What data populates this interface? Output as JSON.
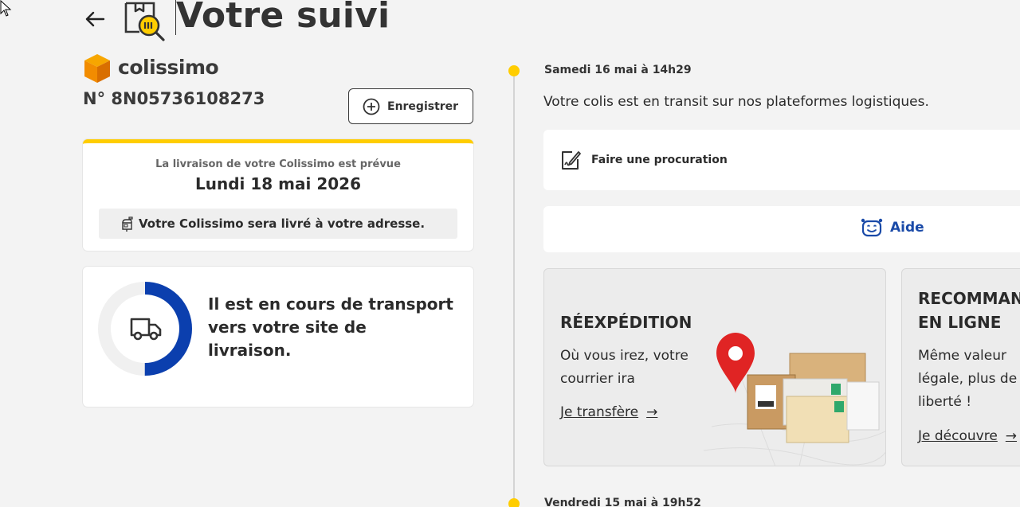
{
  "header": {
    "title": "Votre suivi"
  },
  "brand": {
    "name": "colissimo",
    "tracking_number": "N° 8N05736108273",
    "save_label": "Enregistrer"
  },
  "delivery": {
    "pre_label": "La livraison de votre Colissimo est prévue",
    "date": "Lundi 18 mai 2026",
    "note": "Votre Colissimo sera livré à votre adresse."
  },
  "status": {
    "text": "Il est en cours de transport vers votre site de livraison.",
    "progress": 0.5
  },
  "timeline": {
    "events": [
      {
        "date": "Samedi 16 mai à 14h29",
        "message": "Votre colis est en transit sur nos plateformes logistiques."
      },
      {
        "date": "Vendredi 15 mai à 19h52"
      }
    ]
  },
  "actions": {
    "proxy_label": "Faire une procuration",
    "help_label": "Aide"
  },
  "promos": [
    {
      "title": "RÉEXPÉDITION",
      "desc": "Où vous irez, votre courrier ira",
      "link": "Je transfère",
      "arrow": "→"
    },
    {
      "title": "RECOMMANDÉ EN LIGNE",
      "title_line1": "RECOMMANDÉ",
      "title_line2": "EN LIGNE",
      "desc": "Même valeur légale, plus de liberté !",
      "link": "Je découvre",
      "arrow": "→"
    }
  ],
  "colors": {
    "accent_yellow": "#ffcd00",
    "progress_blue": "#0b3fae",
    "help_blue": "#1a4aa8",
    "brand_orange": "#f28c00"
  }
}
